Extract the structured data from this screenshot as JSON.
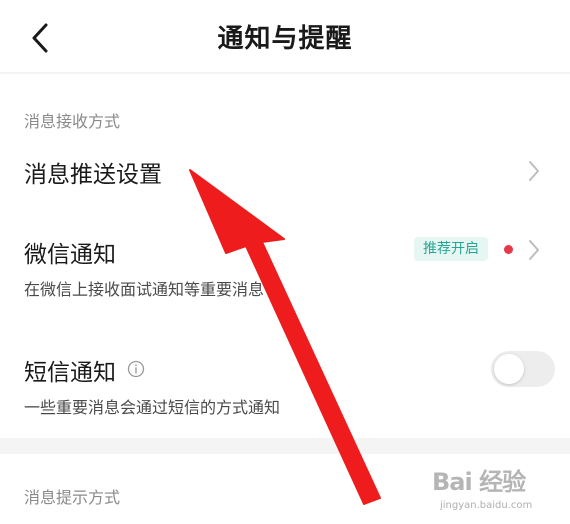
{
  "header": {
    "title": "通知与提醒",
    "back_icon": "chevron-left-icon"
  },
  "sections": [
    {
      "label": "消息接收方式"
    },
    {
      "label": "消息提示方式"
    }
  ],
  "items": {
    "push": {
      "title": "消息推送设置",
      "icon": "chevron-right-icon"
    },
    "wechat": {
      "title": "微信通知",
      "subtitle": "在微信上接收面试通知等重要消息",
      "badge": "推荐开启",
      "badge_color": "#27a594",
      "dot_color": "#e63946",
      "icon": "chevron-right-icon"
    },
    "sms": {
      "title": "短信通知",
      "subtitle": "一些重要消息会通过短信的方式通知",
      "info_icon": "info-circle-icon",
      "toggle_on": false
    }
  },
  "overlay": {
    "arrow_color": "#ee1c1c"
  },
  "watermark": {
    "text": "Bai 经验",
    "url": "jingyan.baidu.com"
  }
}
